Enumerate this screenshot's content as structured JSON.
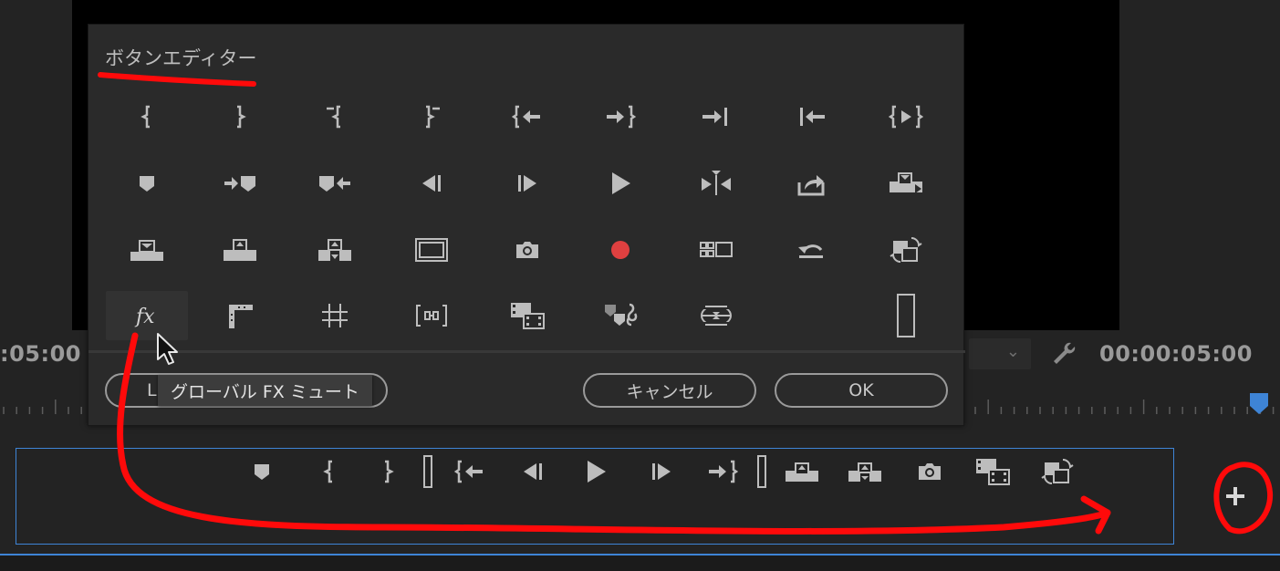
{
  "timecodes": {
    "left": ":05:00",
    "right": "00:00:05:00"
  },
  "dialog": {
    "title": "ボタンエディター",
    "buttons": {
      "left_partial": "L",
      "cancel": "キャンセル",
      "ok": "OK"
    },
    "tooltip": "グローバル FX ミュート",
    "grid_icons": [
      [
        "mark-in-icon",
        "mark-out-icon",
        "clear-in-icon",
        "clear-out-icon",
        "go-to-in-icon",
        "go-to-out-icon",
        "step-to-end-icon",
        "step-to-start-icon",
        "play-in-to-out-icon"
      ],
      [
        "add-marker-icon",
        "go-to-next-marker-icon",
        "go-to-previous-marker-icon",
        "step-back-icon",
        "step-forward-icon",
        "play-icon",
        "play-around-icon",
        "export-icon",
        "overwrite-icon"
      ],
      [
        "lift-icon",
        "extract-icon",
        "insert-icon",
        "safe-margins-icon",
        "export-frame-icon",
        "record-icon",
        "multi-camera-icon",
        "loop-icon",
        "toggle-proxies-icon"
      ],
      [
        "global-fx-mute-icon",
        "comparison-view-icon",
        "show-rulers-icon",
        "show-guides-icon",
        "insert-clip-icon",
        "snap-marker-icon",
        "vr-video-icon",
        "empty-slot",
        "spacer-icon"
      ]
    ],
    "accent_record": "#e04040"
  },
  "control_bar": {
    "icons": [
      "add-marker-icon",
      "mark-in-icon",
      "mark-out-icon",
      "spacer-icon",
      "go-to-in-icon",
      "step-back-icon",
      "play-icon",
      "step-forward-icon",
      "go-to-out-icon",
      "spacer-icon",
      "lift-icon",
      "extract-icon",
      "export-frame-icon",
      "insert-clip-icon",
      "toggle-proxies-icon"
    ],
    "border_color": "#3e84d6"
  },
  "annotation_color": "#ff0a0a"
}
